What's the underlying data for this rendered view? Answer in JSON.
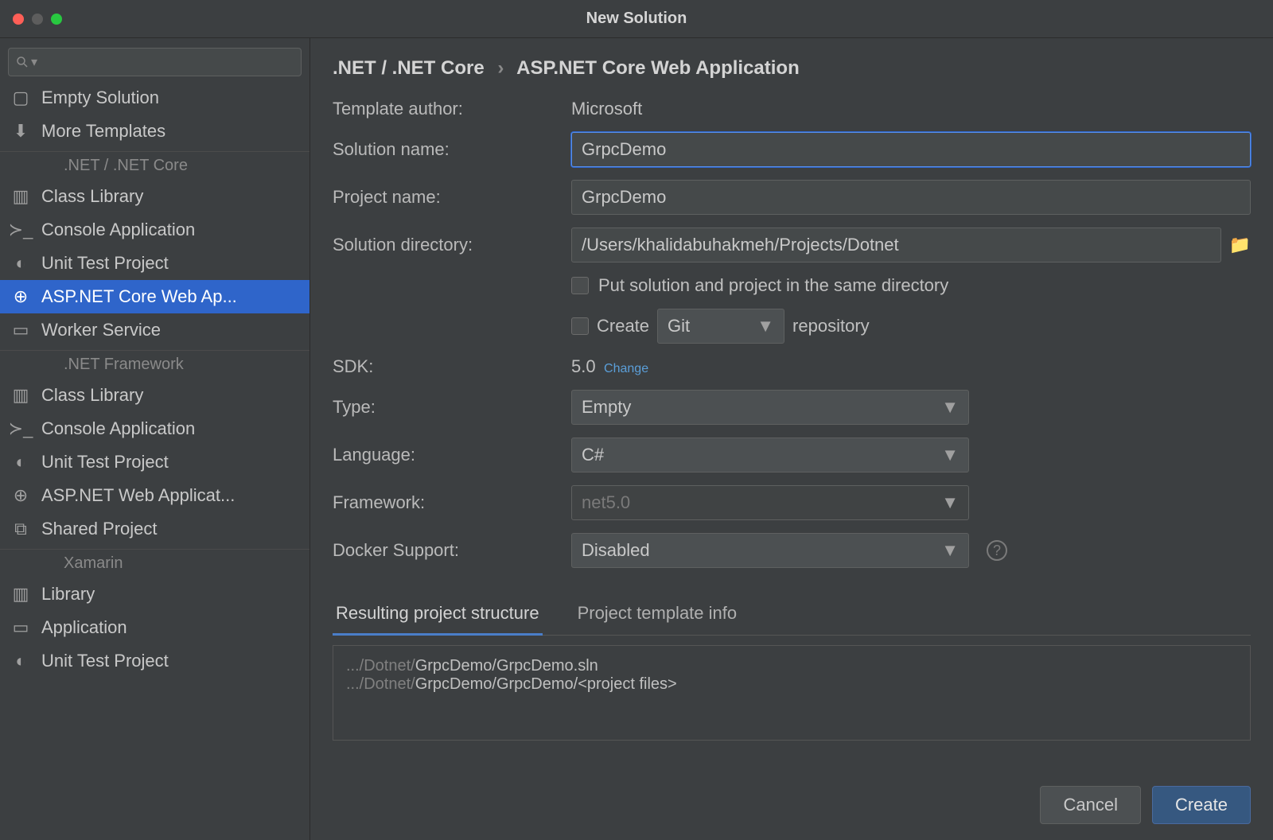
{
  "title": "New Solution",
  "breadcrumb": {
    "parent": ".NET / .NET Core",
    "current": "ASP.NET Core Web Application"
  },
  "sidebar": {
    "top": [
      {
        "icon": "solution",
        "label": "Empty Solution"
      },
      {
        "icon": "download",
        "label": "More Templates"
      }
    ],
    "groups": [
      {
        "title": ".NET / .NET Core",
        "items": [
          {
            "icon": "books",
            "label": "Class Library"
          },
          {
            "icon": "console",
            "label": "Console Application"
          },
          {
            "icon": "test",
            "label": "Unit Test Project"
          },
          {
            "icon": "globe",
            "label": "ASP.NET Core Web Ap...",
            "selected": true
          },
          {
            "icon": "window",
            "label": "Worker Service"
          }
        ]
      },
      {
        "title": ".NET Framework",
        "items": [
          {
            "icon": "books",
            "label": "Class Library"
          },
          {
            "icon": "console",
            "label": "Console Application"
          },
          {
            "icon": "test",
            "label": "Unit Test Project"
          },
          {
            "icon": "globe",
            "label": "ASP.NET Web Applicat..."
          },
          {
            "icon": "shared",
            "label": "Shared Project"
          }
        ]
      },
      {
        "title": "Xamarin",
        "items": [
          {
            "icon": "books",
            "label": "Library"
          },
          {
            "icon": "window",
            "label": "Application"
          },
          {
            "icon": "test",
            "label": "Unit Test Project"
          }
        ]
      }
    ]
  },
  "form": {
    "template_author_label": "Template author:",
    "template_author": "Microsoft",
    "solution_name_label": "Solution name:",
    "solution_name": "GrpcDemo",
    "project_name_label": "Project name:",
    "project_name": "GrpcDemo",
    "solution_dir_label": "Solution directory:",
    "solution_dir": "/Users/khalidabuhakmeh/Projects/Dotnet",
    "same_dir_label": "Put solution and project in the same directory",
    "create_label": "Create",
    "vcs": "Git",
    "repository_label": "repository",
    "sdk_label": "SDK:",
    "sdk_value": "5.0",
    "sdk_change": "Change",
    "type_label": "Type:",
    "type_value": "Empty",
    "language_label": "Language:",
    "language_value": "C#",
    "framework_label": "Framework:",
    "framework_value": "net5.0",
    "docker_label": "Docker Support:",
    "docker_value": "Disabled"
  },
  "tabs": {
    "structure": "Resulting project structure",
    "info": "Project template info"
  },
  "output": {
    "line1_prefix": ".../Dotnet/",
    "line1_bold": "GrpcDemo/GrpcDemo.sln",
    "line2_prefix": ".../Dotnet/",
    "line2_bold": "GrpcDemo/GrpcDemo/<project files>"
  },
  "footer": {
    "cancel": "Cancel",
    "create": "Create"
  }
}
